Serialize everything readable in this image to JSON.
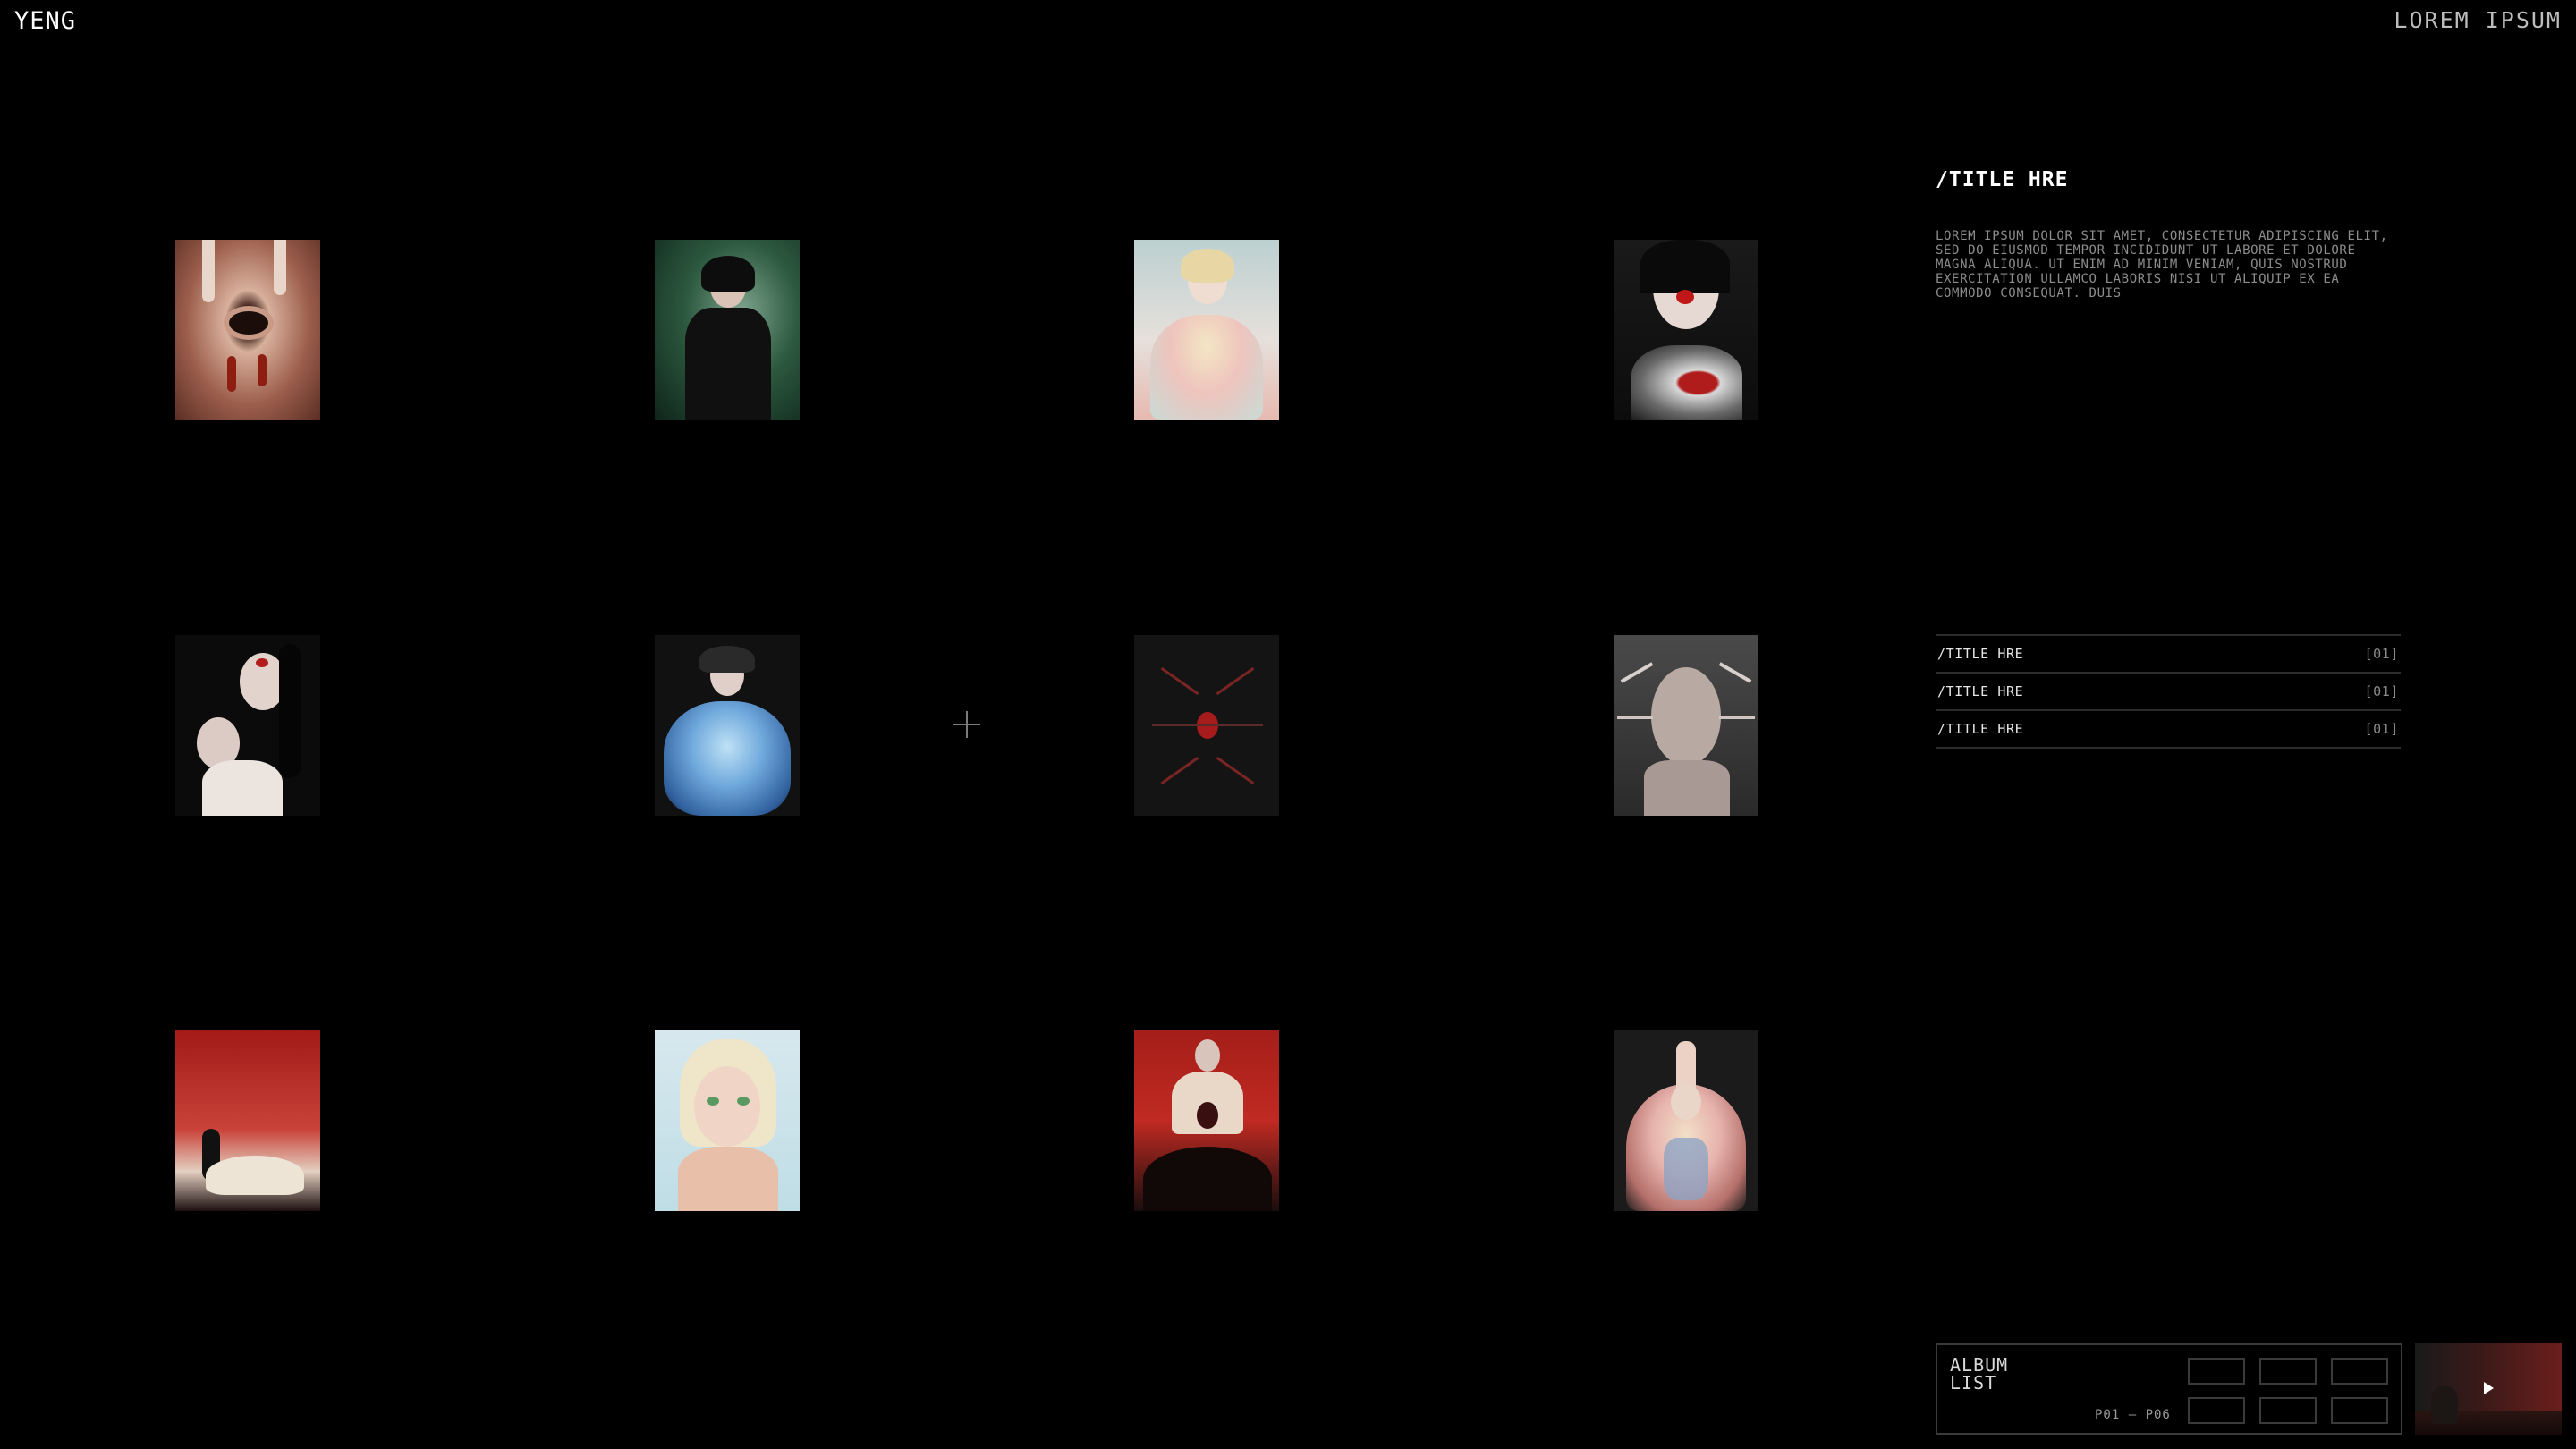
{
  "header": {
    "logo": "YENG",
    "right_link": "LOREM IPSUM"
  },
  "gallery": {
    "items": [
      {
        "name": "eye-with-red-nails-cover",
        "palette": [
          "#8c5a4a",
          "#d9b7a6",
          "#b23a2c"
        ]
      },
      {
        "name": "woman-in-black-on-green-cover",
        "palette": [
          "#163826",
          "#6e8f78",
          "#111111"
        ]
      },
      {
        "name": "blonde-in-pastel-ruffles-cover",
        "palette": [
          "#c9d6d4",
          "#e8cfc8",
          "#d7c07a"
        ]
      },
      {
        "name": "dark-hair-with-chrome-cover",
        "palette": [
          "#141414",
          "#d9cfcb",
          "#b01c1c"
        ]
      },
      {
        "name": "two-faces-black-hair-cover",
        "palette": [
          "#0b0b0b",
          "#e1d5d1",
          "#a31414"
        ]
      },
      {
        "name": "blue-ruffle-dress-cover",
        "palette": [
          "#121212",
          "#7fb5e0",
          "#3b6fb0"
        ]
      },
      {
        "name": "red-insect-emblem-cover",
        "palette": [
          "#151515",
          "#a61c1c",
          "#6b1414"
        ]
      },
      {
        "name": "sculpted-head-with-spikes-cover",
        "palette": [
          "#3a3a3a",
          "#b9aaa4",
          "#7c6f6a"
        ]
      },
      {
        "name": "red-sky-white-gown-cover",
        "palette": [
          "#a11b17",
          "#e6dccb",
          "#1a0f0f"
        ]
      },
      {
        "name": "blonde-with-green-makeup-cover",
        "palette": [
          "#cfe3e9",
          "#e7c9b2",
          "#5a9a62"
        ]
      },
      {
        "name": "red-stage-figures-cover",
        "palette": [
          "#a8201b",
          "#e9d8c8",
          "#140b0b"
        ]
      },
      {
        "name": "pink-ruffle-dancer-cover",
        "palette": [
          "#1b1b1b",
          "#e7b3ad",
          "#8aa3c6"
        ]
      }
    ]
  },
  "panel": {
    "title": "/TITLE HRE",
    "description": "LOREM IPSUM DOLOR SIT AMET, CONSECTETUR ADIPISCING ELIT, SED DO EIUSMOD TEMPOR INCIDIDUNT UT LABORE ET DOLORE MAGNA ALIQUA. UT ENIM AD MINIM VENIAM, QUIS NOSTRUD EXERCITATION ULLAMCO LABORIS NISI UT ALIQUIP EX EA COMMODO CONSEQUAT. DUIS",
    "list": [
      {
        "label": "/TITLE HRE",
        "index": "[01]"
      },
      {
        "label": "/TITLE HRE",
        "index": "[01]"
      },
      {
        "label": "/TITLE HRE",
        "index": "[01]"
      }
    ]
  },
  "album": {
    "label": "ALBUM\nLIST",
    "range": "P01 — P06"
  },
  "player": {
    "icon": "play-icon"
  }
}
